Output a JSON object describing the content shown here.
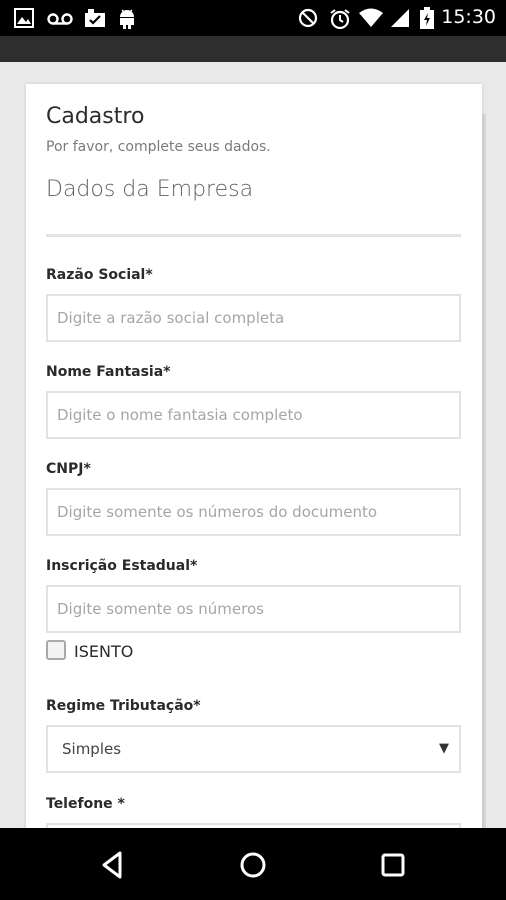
{
  "status_bar": {
    "time": "15:30",
    "left_icons": [
      "image-icon",
      "voicemail-icon",
      "download-done-icon",
      "android-icon"
    ],
    "right_icons": [
      "do-not-disturb-icon",
      "alarm-icon",
      "wifi-icon",
      "signal-icon",
      "battery-charging-icon"
    ]
  },
  "form": {
    "title": "Cadastro",
    "subtitle": "Por favor, complete seus dados.",
    "section": "Dados da Empresa",
    "fields": {
      "razao_social": {
        "label": "Razão Social*",
        "placeholder": "Digite a razão social completa",
        "value": ""
      },
      "nome_fantasia": {
        "label": "Nome Fantasia*",
        "placeholder": "Digite o nome fantasia completo",
        "value": ""
      },
      "cnpj": {
        "label": "CNPJ*",
        "placeholder": "Digite somente os números do documento",
        "value": ""
      },
      "inscricao_estadual": {
        "label": "Inscrição Estadual*",
        "placeholder": "Digite somente os números",
        "value": ""
      },
      "regime_tributacao": {
        "label": "Regime Tributação*",
        "selected": "Simples"
      },
      "telefone": {
        "label": "Telefone *"
      }
    },
    "isento": {
      "label": "ISENTO",
      "checked": false
    }
  },
  "nav_bar": {
    "buttons": [
      "back-icon",
      "home-icon",
      "recents-icon"
    ]
  },
  "colors": {
    "status_bar": "#000000",
    "app_strip": "#2e2e2e",
    "page_bg": "#e9e9e9",
    "card": "#ffffff",
    "border": "#e2e2e2"
  }
}
